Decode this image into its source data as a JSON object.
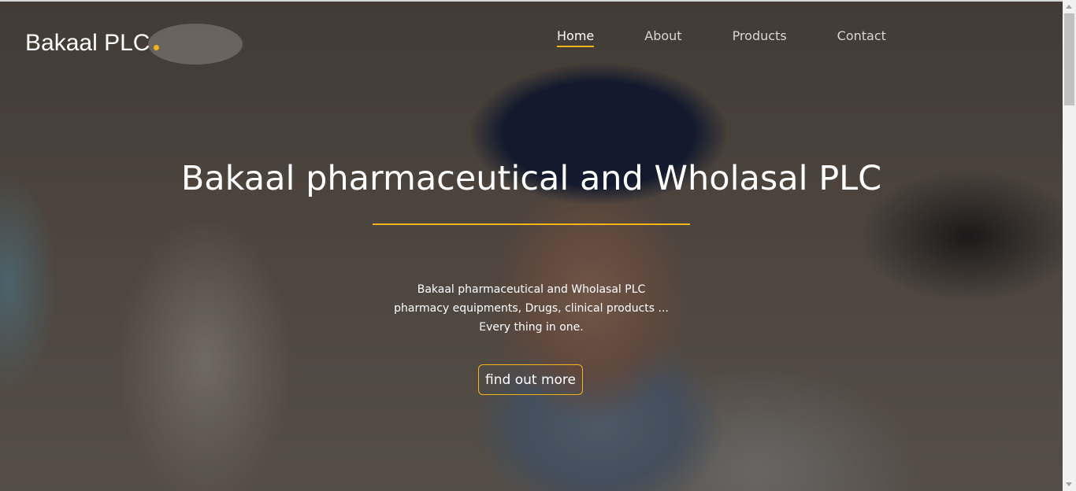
{
  "brand": {
    "name": "Bakaal PLC",
    "accent_color": "#f0b41c"
  },
  "nav": {
    "items": [
      {
        "label": "Home",
        "active": true
      },
      {
        "label": "About",
        "active": false
      },
      {
        "label": "Products",
        "active": false
      },
      {
        "label": "Contact",
        "active": false
      }
    ]
  },
  "hero": {
    "title": "Bakaal pharmaceutical and Wholasal PLC",
    "description": [
      "Bakaal pharmaceutical and Wholasal PLC",
      "pharmacy equipments, Drugs, clinical products ...",
      "Every thing in one."
    ],
    "cta_label": "find out more"
  }
}
